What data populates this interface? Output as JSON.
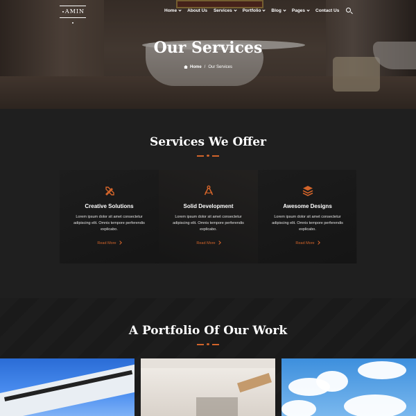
{
  "nav": {
    "logo": "AMIN",
    "items": [
      {
        "label": "Home",
        "caret": true
      },
      {
        "label": "About Us",
        "caret": false
      },
      {
        "label": "Services",
        "caret": true
      },
      {
        "label": "Portfolio",
        "caret": true
      },
      {
        "label": "Blog",
        "caret": true
      },
      {
        "label": "Pages",
        "caret": true
      },
      {
        "label": "Contact Us",
        "caret": false
      }
    ],
    "search_icon": "search-icon"
  },
  "hero": {
    "title": "Our Services",
    "breadcrumb": {
      "home": "Home",
      "separator": "/",
      "current": "Our Services"
    }
  },
  "services": {
    "title": "Services We Offer",
    "cards": [
      {
        "icon": "tools-icon",
        "title": "Creative Solutions",
        "description": "Lorem ipsum dolor sit amet consectetur adipiscing elit. Omnis tempore perferendis explicabo.",
        "link": "Read More"
      },
      {
        "icon": "compass-icon",
        "title": "Solid Development",
        "description": "Lorem ipsum dolor sit amet consectetur adipiscing elit. Omnis tempore perferendis explicabo.",
        "link": "Read More"
      },
      {
        "icon": "layers-icon",
        "title": "Awesome Designs",
        "description": "Lorem ipsum dolor sit amet consectetur adipiscing elit. Omnis tempore perferendis explicabo.",
        "link": "Read More"
      }
    ]
  },
  "portfolio": {
    "title": "A Portfolio Of Our Work"
  },
  "colors": {
    "accent": "#d2642a",
    "background": "#1f1f1f",
    "card_background": "#161616"
  }
}
